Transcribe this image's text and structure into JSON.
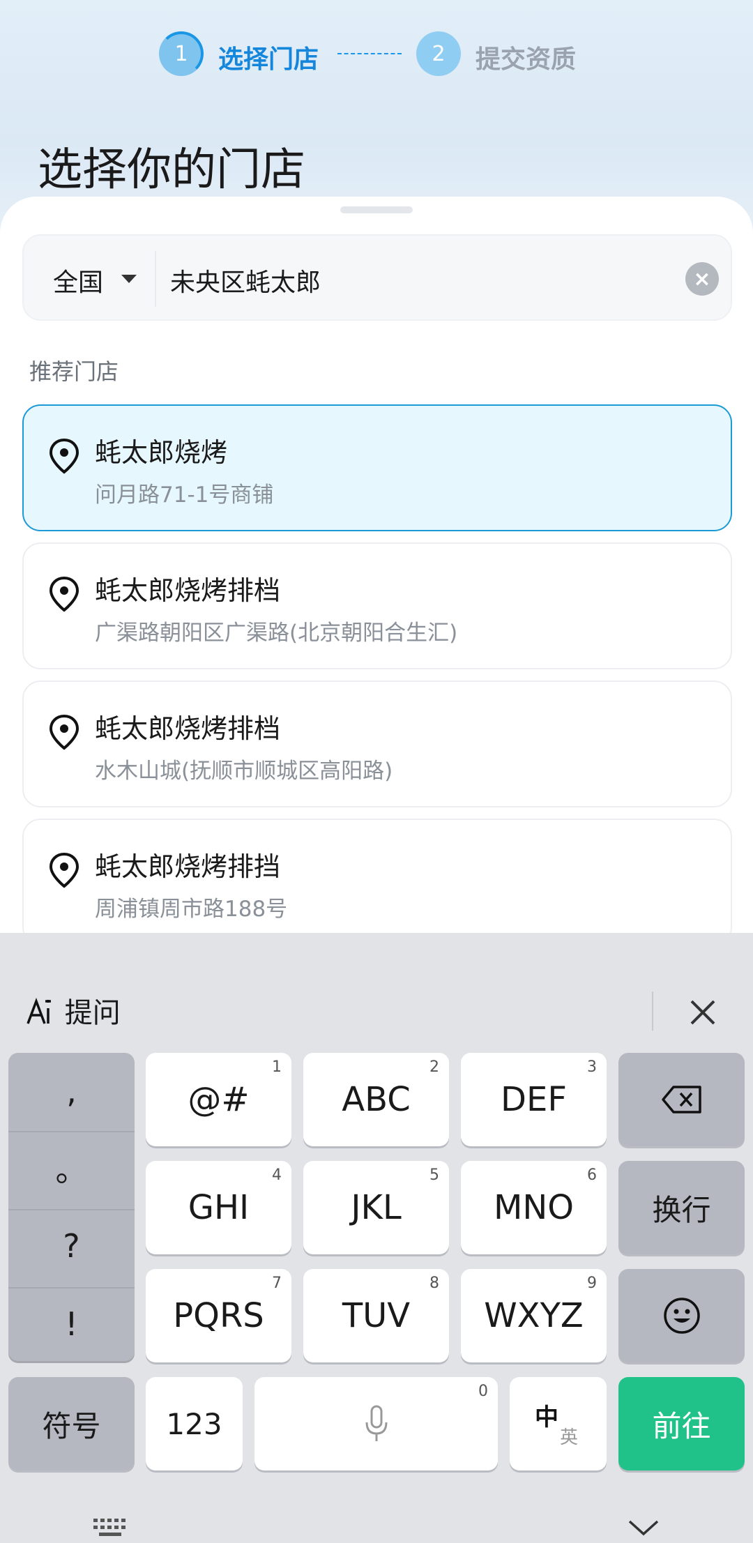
{
  "stepper": {
    "step1_num": "1",
    "step1_label": "选择门店",
    "step2_num": "2",
    "step2_label": "提交资质"
  },
  "page_title": "选择你的门店",
  "search": {
    "region": "全国",
    "query": "未央区蚝太郎",
    "clear_icon": "×"
  },
  "section_label": "推荐门店",
  "stores": [
    {
      "name": "蚝太郎烧烤",
      "address": "问月路71-1号商铺",
      "selected": true
    },
    {
      "name": "蚝太郎烧烤排档",
      "address": "广渠路朝阳区广渠路(北京朝阳合生汇)",
      "selected": false
    },
    {
      "name": "蚝太郎烧烤排档",
      "address": "水木山城(抚顺市顺城区高阳路)",
      "selected": false
    },
    {
      "name": "蚝太郎烧烤排挡",
      "address": "周浦镇周市路188号",
      "selected": false
    }
  ],
  "keyboard": {
    "ai_label": "提问",
    "punct": [
      ",",
      "。",
      "?",
      "!"
    ],
    "keys": [
      {
        "label": "@#",
        "num": "1"
      },
      {
        "label": "ABC",
        "num": "2"
      },
      {
        "label": "DEF",
        "num": "3"
      },
      {
        "label": "GHI",
        "num": "4"
      },
      {
        "label": "JKL",
        "num": "5"
      },
      {
        "label": "MNO",
        "num": "6"
      },
      {
        "label": "PQRS",
        "num": "7"
      },
      {
        "label": "TUV",
        "num": "8"
      },
      {
        "label": "WXYZ",
        "num": "9"
      }
    ],
    "newline": "换行",
    "symbols": "符号",
    "numbers": "123",
    "space_num": "0",
    "lang_main": "中",
    "lang_sub": "英",
    "go": "前往"
  },
  "colors": {
    "accent": "#1486db",
    "selected_border": "#1b9ad6",
    "go_button": "#20c28a"
  }
}
